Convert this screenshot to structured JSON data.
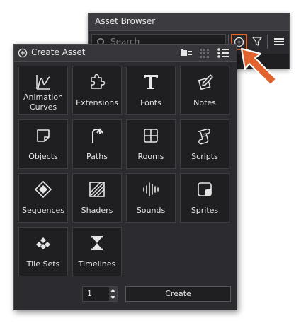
{
  "asset_browser": {
    "title": "Asset Browser",
    "search_placeholder": "Search"
  },
  "create_asset": {
    "title": "Create Asset",
    "tiles": [
      {
        "label": "Animation\nCurves",
        "icon": "animation-curve-icon"
      },
      {
        "label": "Extensions",
        "icon": "puzzle-icon"
      },
      {
        "label": "Fonts",
        "icon": "font-t-icon"
      },
      {
        "label": "Notes",
        "icon": "notes-icon"
      },
      {
        "label": "Objects",
        "icon": "object-icon"
      },
      {
        "label": "Paths",
        "icon": "path-icon"
      },
      {
        "label": "Rooms",
        "icon": "room-icon"
      },
      {
        "label": "Scripts",
        "icon": "script-icon"
      },
      {
        "label": "Sequences",
        "icon": "sequence-icon"
      },
      {
        "label": "Shaders",
        "icon": "shader-icon"
      },
      {
        "label": "Sounds",
        "icon": "sound-icon"
      },
      {
        "label": "Sprites",
        "icon": "sprite-icon"
      },
      {
        "label": "Tile Sets",
        "icon": "tileset-icon"
      },
      {
        "label": "Timelines",
        "icon": "timeline-icon"
      }
    ],
    "count": "1",
    "create_label": "Create"
  },
  "colors": {
    "accent": "#e2632e",
    "panel_bg": "#2c2c30",
    "tile_bg": "#1f1f22"
  }
}
